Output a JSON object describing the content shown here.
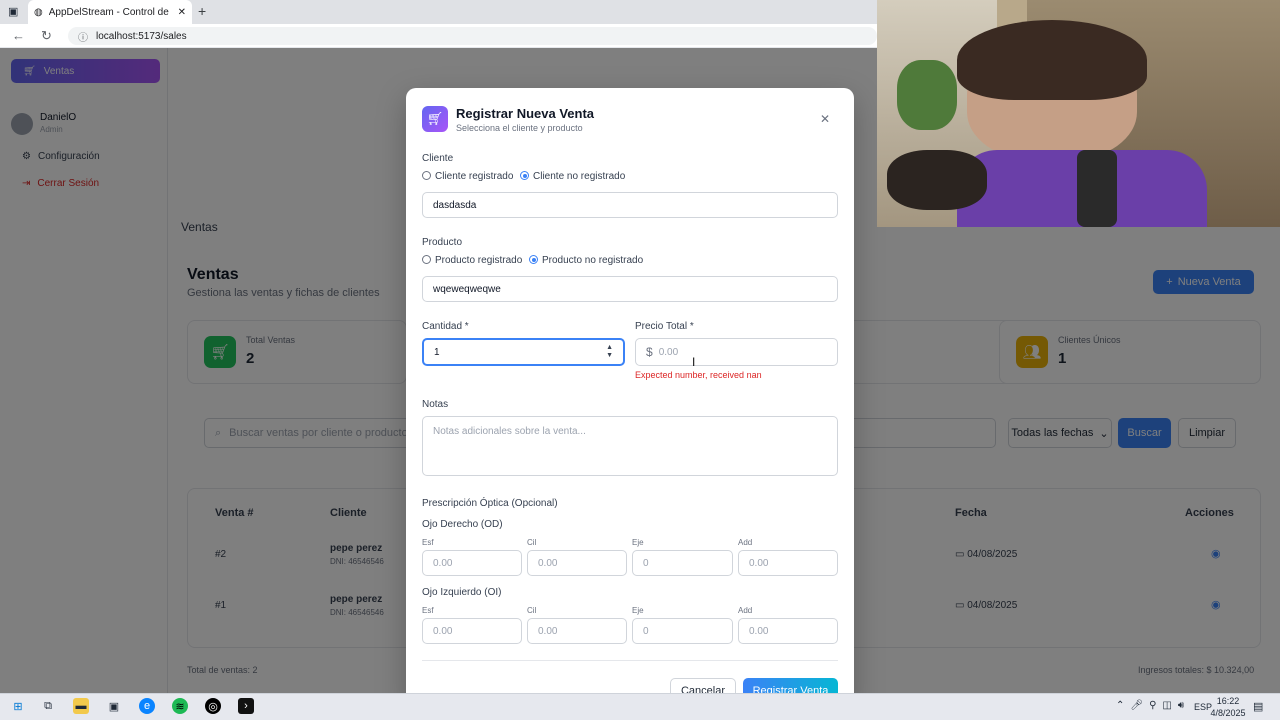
{
  "browser": {
    "tab_title": "AppDelStream - Control de Stock",
    "url": "localhost:5173/sales"
  },
  "sidebar": {
    "active_item": "Ventas",
    "user_name": "DanielO",
    "user_role": "Admin",
    "items": [
      "Configuración",
      "Cerrar Sesión"
    ]
  },
  "page": {
    "breadcrumb": "Ventas",
    "title": "Ventas",
    "subtitle": "Gestiona las ventas y fichas de clientes",
    "new_button": "Nueva Venta",
    "stats": [
      {
        "label": "Total Ventas",
        "value": "2",
        "color": "#22c55e",
        "icon": "cart-icon"
      },
      {
        "label": "Clientes Únicos",
        "value": "1",
        "color": "#eab308",
        "icon": "users-icon"
      }
    ],
    "search_placeholder": "Buscar ventas por cliente o producto...",
    "date_filter": "Todas las fechas",
    "search_button": "Buscar",
    "clear_button": "Limpiar",
    "table": {
      "headers": [
        "Venta #",
        "Cliente",
        "Fecha",
        "Acciones"
      ],
      "rows": [
        {
          "id": "#2",
          "client": "pepe perez",
          "dni": "DNI: 46546546",
          "date": "04/08/2025"
        },
        {
          "id": "#1",
          "client": "pepe perez",
          "dni": "DNI: 46546546",
          "date": "04/08/2025"
        }
      ]
    },
    "footer_left": "Total de ventas: 2",
    "footer_right": "Ingresos totales: $ 10.324,00"
  },
  "modal": {
    "title": "Registrar Nueva Venta",
    "subtitle": "Selecciona el cliente y producto",
    "cliente": {
      "label": "Cliente",
      "option_registered": "Cliente registrado",
      "option_unregistered": "Cliente no registrado",
      "value": "dasdasda"
    },
    "producto": {
      "label": "Producto",
      "option_registered": "Producto registrado",
      "option_unregistered": "Producto no registrado",
      "value": "wqeweqweqwe"
    },
    "cantidad": {
      "label": "Cantidad *",
      "value": "1"
    },
    "precio": {
      "label": "Precio Total *",
      "currency": "$",
      "placeholder": "0.00",
      "error": "Expected number, received nan"
    },
    "notas": {
      "label": "Notas",
      "placeholder": "Notas adicionales sobre la venta..."
    },
    "prescripcion": {
      "title": "Prescripción Óptica (Opcional)",
      "od_title": "Ojo Derecho (OD)",
      "oi_title": "Ojo Izquierdo (OI)",
      "fields": [
        {
          "label": "Esf",
          "placeholder": "0.00"
        },
        {
          "label": "Cil",
          "placeholder": "0.00"
        },
        {
          "label": "Eje",
          "placeholder": "0"
        },
        {
          "label": "Add",
          "placeholder": "0.00"
        }
      ]
    },
    "cancel": "Cancelar",
    "submit": "Registrar Venta"
  },
  "taskbar": {
    "lang": "ESP",
    "time": "16:22",
    "date": "4/8/2025"
  }
}
